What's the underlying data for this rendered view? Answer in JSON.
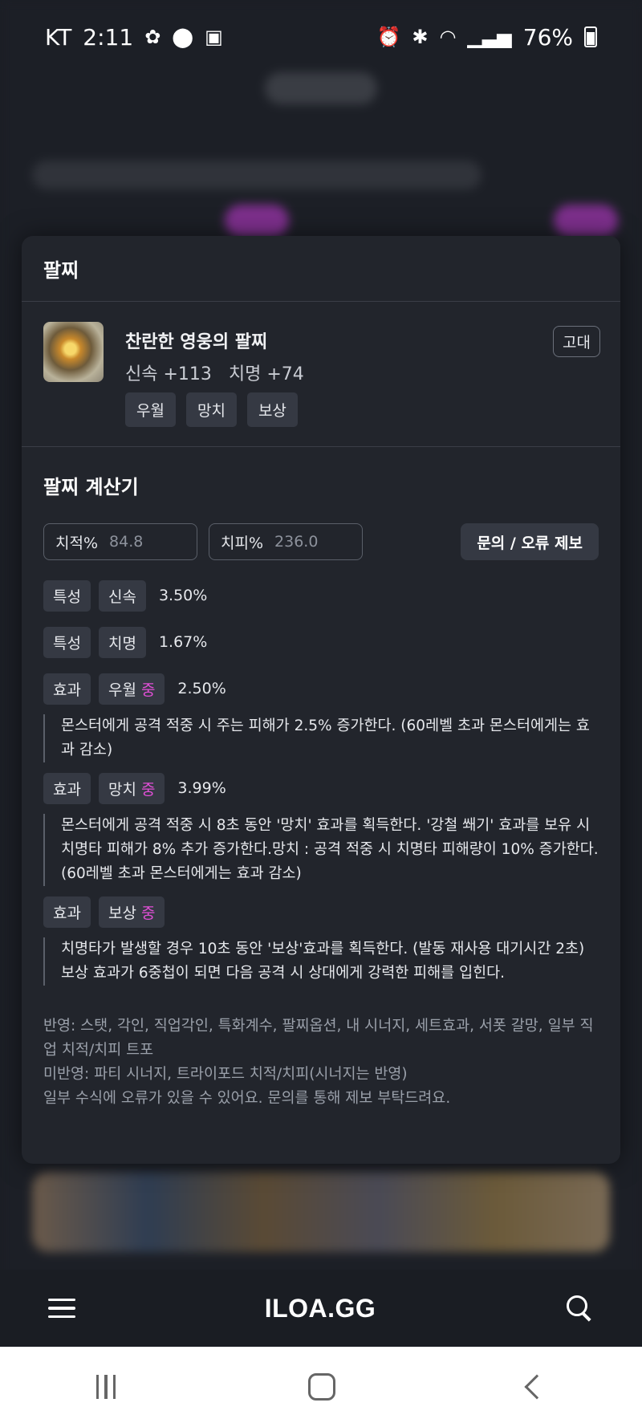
{
  "status_bar": {
    "carrier": "KT",
    "time": "2:11",
    "battery": "76%"
  },
  "modal": {
    "header": "팔찌",
    "item": {
      "name": "찬란한 영웅의 팔찌",
      "stats": "신속 +113   치명 +74",
      "tags": [
        "우월",
        "망치",
        "보상"
      ],
      "grade": "고대"
    },
    "calculator": {
      "title": "팔찌 계산기",
      "crit_rate": {
        "label": "치적%",
        "value": "84.8"
      },
      "crit_damage": {
        "label": "치피%",
        "value": "236.0"
      },
      "report_button": "문의 / 오류 제보",
      "rows": [
        {
          "type": "특성",
          "name": "신속",
          "level": "",
          "value": "3.50%",
          "desc": ""
        },
        {
          "type": "특성",
          "name": "치명",
          "level": "",
          "value": "1.67%",
          "desc": ""
        },
        {
          "type": "효과",
          "name": "우월",
          "level": "중",
          "value": "2.50%",
          "desc": "몬스터에게 공격 적중 시 주는 피해가 2.5% 증가한다. (60레벨 초과 몬스터에게는 효과 감소)"
        },
        {
          "type": "효과",
          "name": "망치",
          "level": "중",
          "value": "3.99%",
          "desc": "몬스터에게 공격 적중 시 8초 동안 '망치' 효과를 획득한다. '강철 쐐기' 효과를 보유 시 치명타 피해가 8% 추가 증가한다.망치 : 공격 적중 시 치명타 피해량이 10% 증가한다. (60레벨 초과 몬스터에게는 효과 감소)"
        },
        {
          "type": "효과",
          "name": "보상",
          "level": "중",
          "value": "",
          "desc": "치명타가 발생할 경우 10초 동안 '보상'효과를 획득한다. (발동 재사용 대기시간 2초) 보상 효과가 6중첩이 되면 다음 공격 시 상대에게 강력한 피해를 입힌다."
        }
      ],
      "notes": [
        "반영: 스탯, 각인, 직업각인, 특화계수, 팔찌옵션, 내 시너지, 세트효과, 서폿 갈망, 일부 직업 치적/치피 트포",
        "미반영: 파티 시너지, 트라이포드 치적/치피(시너지는 반영)",
        "일부 수식에 오류가 있을 수 있어요. 문의를 통해 제보 부탁드려요."
      ]
    }
  },
  "bottom_bar": {
    "logo": "ILOA.GG"
  },
  "colors": {
    "level_accent": "#e04fd6",
    "card_bg": "#22252c",
    "chip_bg": "#353943"
  }
}
